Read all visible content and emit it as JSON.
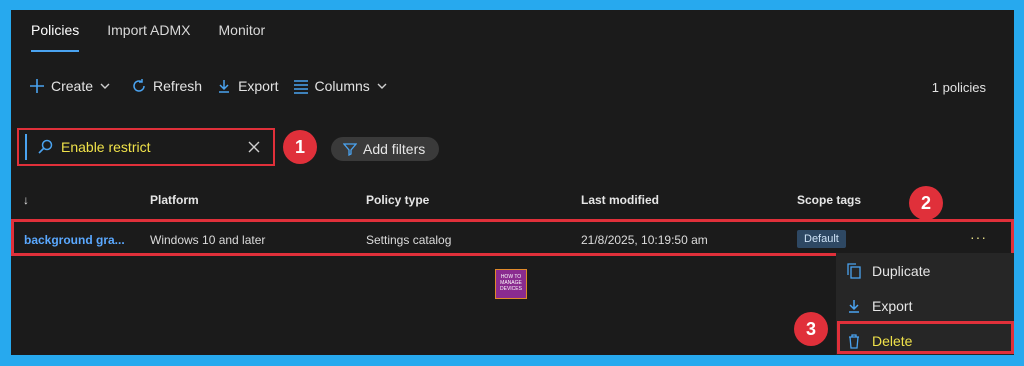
{
  "tabs": [
    {
      "label": "Policies",
      "active": true
    },
    {
      "label": "Import ADMX",
      "active": false
    },
    {
      "label": "Monitor",
      "active": false
    }
  ],
  "toolbar": {
    "create": "Create",
    "refresh": "Refresh",
    "export": "Export",
    "columns": "Columns"
  },
  "count_label": "1 policies",
  "search": {
    "value": "Enable restrict"
  },
  "filters_label": "Add filters",
  "columns": {
    "name_sort": "↓",
    "platform": "Platform",
    "policy_type": "Policy type",
    "last_modified": "Last modified",
    "scope_tags": "Scope tags"
  },
  "rows": [
    {
      "name": "background gra...",
      "platform": "Windows 10 and later",
      "policy_type": "Settings catalog",
      "last_modified": "21/8/2025, 10:19:50 am",
      "scope_tag": "Default",
      "more": "···"
    }
  ],
  "context_menu": [
    {
      "label": "Duplicate",
      "icon": "duplicate-icon"
    },
    {
      "label": "Export",
      "icon": "download-icon"
    },
    {
      "label": "Delete",
      "icon": "trash-icon"
    }
  ],
  "annotations": [
    "1",
    "2",
    "3"
  ],
  "logo_text": {
    "line1": "HOW TO",
    "line2": "MANAGE",
    "line3": "DEVICES"
  },
  "colors": {
    "background": "#27a9ee",
    "panel": "#1b1b1b",
    "highlight": "#e0303a",
    "accent": "#4aa3f0",
    "search_text": "#f0e24a"
  }
}
